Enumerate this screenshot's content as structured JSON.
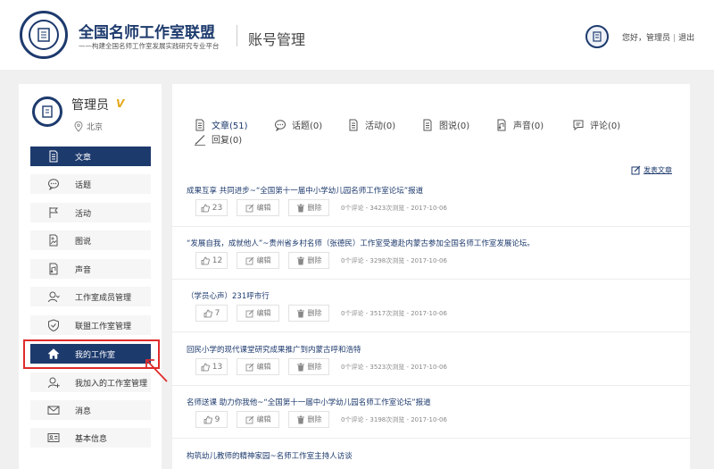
{
  "header": {
    "brand_title": "全国名师工作室联盟",
    "brand_sub": "——构建全国名师工作室发展实践研究专业平台",
    "page_title": "账号管理",
    "greeting": "您好，",
    "user": "管理员",
    "separator": "|",
    "logout": "退出"
  },
  "profile": {
    "name": "管理员",
    "badge": "V",
    "location": "北京"
  },
  "sidebar": {
    "items": [
      {
        "label": "文章",
        "icon": "document-icon"
      },
      {
        "label": "话题",
        "icon": "chat-bubble-icon"
      },
      {
        "label": "活动",
        "icon": "flag-icon"
      },
      {
        "label": "图说",
        "icon": "image-icon"
      },
      {
        "label": "声音",
        "icon": "audio-file-icon"
      },
      {
        "label": "工作室成员管理",
        "icon": "member-icon"
      },
      {
        "label": "联盟工作室管理",
        "icon": "shield-icon"
      },
      {
        "label": "我的工作室",
        "icon": "home-icon"
      },
      {
        "label": "我加入的工作室管理",
        "icon": "join-icon"
      },
      {
        "label": "消息",
        "icon": "envelope-icon"
      },
      {
        "label": "基本信息",
        "icon": "id-card-icon"
      }
    ],
    "active_index": 0,
    "highlighted_index": 7
  },
  "tabs": [
    {
      "label": "文章(51)"
    },
    {
      "label": "话题(0)"
    },
    {
      "label": "活动(0)"
    },
    {
      "label": "图说(0)"
    },
    {
      "label": "声音(0)"
    },
    {
      "label": "评论(0)"
    },
    {
      "label": "回复(0)"
    }
  ],
  "post_button": "发表文章",
  "actions": {
    "edit": "编辑",
    "delete": "删除"
  },
  "articles": [
    {
      "title": "成果互享 共同进步~“全国第十一届中小学幼儿园名师工作室论坛”报道",
      "likes": "23",
      "meta": "0个评论 - 3423次浏览 - 2017-10-06"
    },
    {
      "title": "“发展自我，成就他人”~贵州省乡村名师（张德民）工作室受邀赴内蒙古参加全国名师工作室发展论坛。",
      "likes": "12",
      "meta": "0个评论 - 3298次浏览 - 2017-10-06"
    },
    {
      "title": "（学员心声）231呼市行",
      "likes": "7",
      "meta": "0个评论 - 3517次浏览 - 2017-10-06"
    },
    {
      "title": "回民小学的现代课堂研究成果推广到内蒙古呼和浩特",
      "likes": "13",
      "meta": "0个评论 - 3523次浏览 - 2017-10-06"
    },
    {
      "title": "名师送课 助力你我他~“全国第十一届中小学幼儿园名师工作室论坛”报道",
      "likes": "9",
      "meta": "0个评论 - 3198次浏览 - 2017-10-06"
    },
    {
      "title": "构筑幼儿教师的精神家园~名师工作室主持人访谈"
    }
  ],
  "colors": {
    "primary": "#1d3a6d",
    "highlight": "#e02b2b",
    "badge": "#e4a81a"
  }
}
